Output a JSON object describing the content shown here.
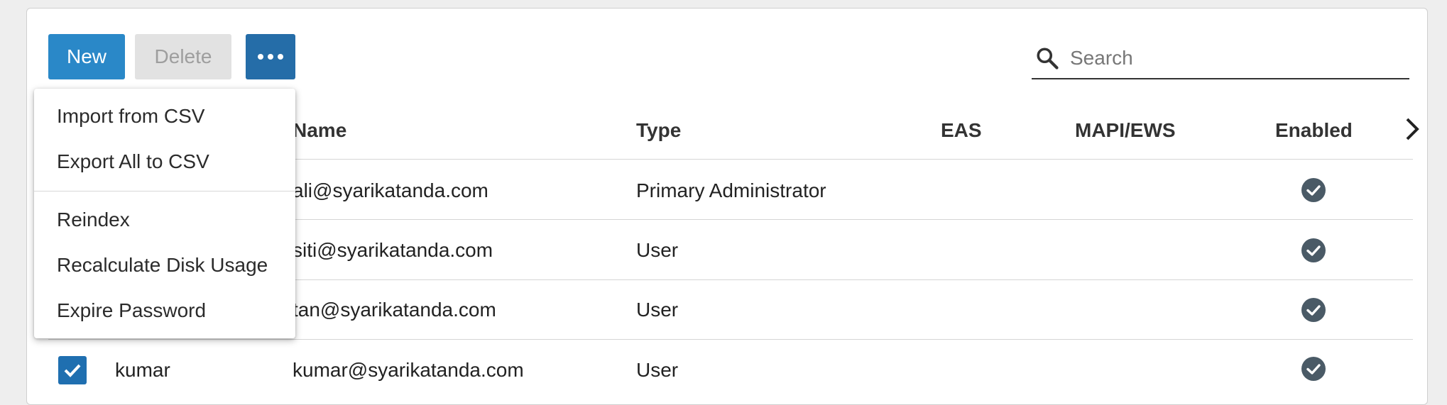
{
  "toolbar": {
    "new_label": "New",
    "delete_label": "Delete",
    "more_icon": "more-horizontal-icon"
  },
  "search": {
    "placeholder": "Search",
    "value": ""
  },
  "table": {
    "columns": [
      "Name",
      "Type",
      "EAS",
      "MAPI/EWS",
      "Enabled"
    ],
    "rows": [
      {
        "username": "",
        "name": "ali@syarikatanda.com",
        "type": "Primary Administrator",
        "eas": "",
        "mapi": "",
        "enabled": true
      },
      {
        "username": "",
        "name": "siti@syarikatanda.com",
        "type": "User",
        "eas": "",
        "mapi": "",
        "enabled": true
      },
      {
        "username": "",
        "name": "tan@syarikatanda.com",
        "type": "User",
        "eas": "",
        "mapi": "",
        "enabled": true
      },
      {
        "username": "kumar",
        "name": "kumar@syarikatanda.com",
        "type": "User",
        "eas": "",
        "mapi": "",
        "enabled": true,
        "selected": true
      }
    ]
  },
  "menu": {
    "items": [
      "Import from CSV",
      "Export All to CSV",
      "Reindex",
      "Recalculate Disk Usage",
      "Expire Password"
    ]
  },
  "colors": {
    "primary": "#2a88c8",
    "primary_dark": "#256da8",
    "disabled": "#e2e2e2",
    "check": "#4a5a66",
    "checkbox": "#1f6fb0"
  }
}
